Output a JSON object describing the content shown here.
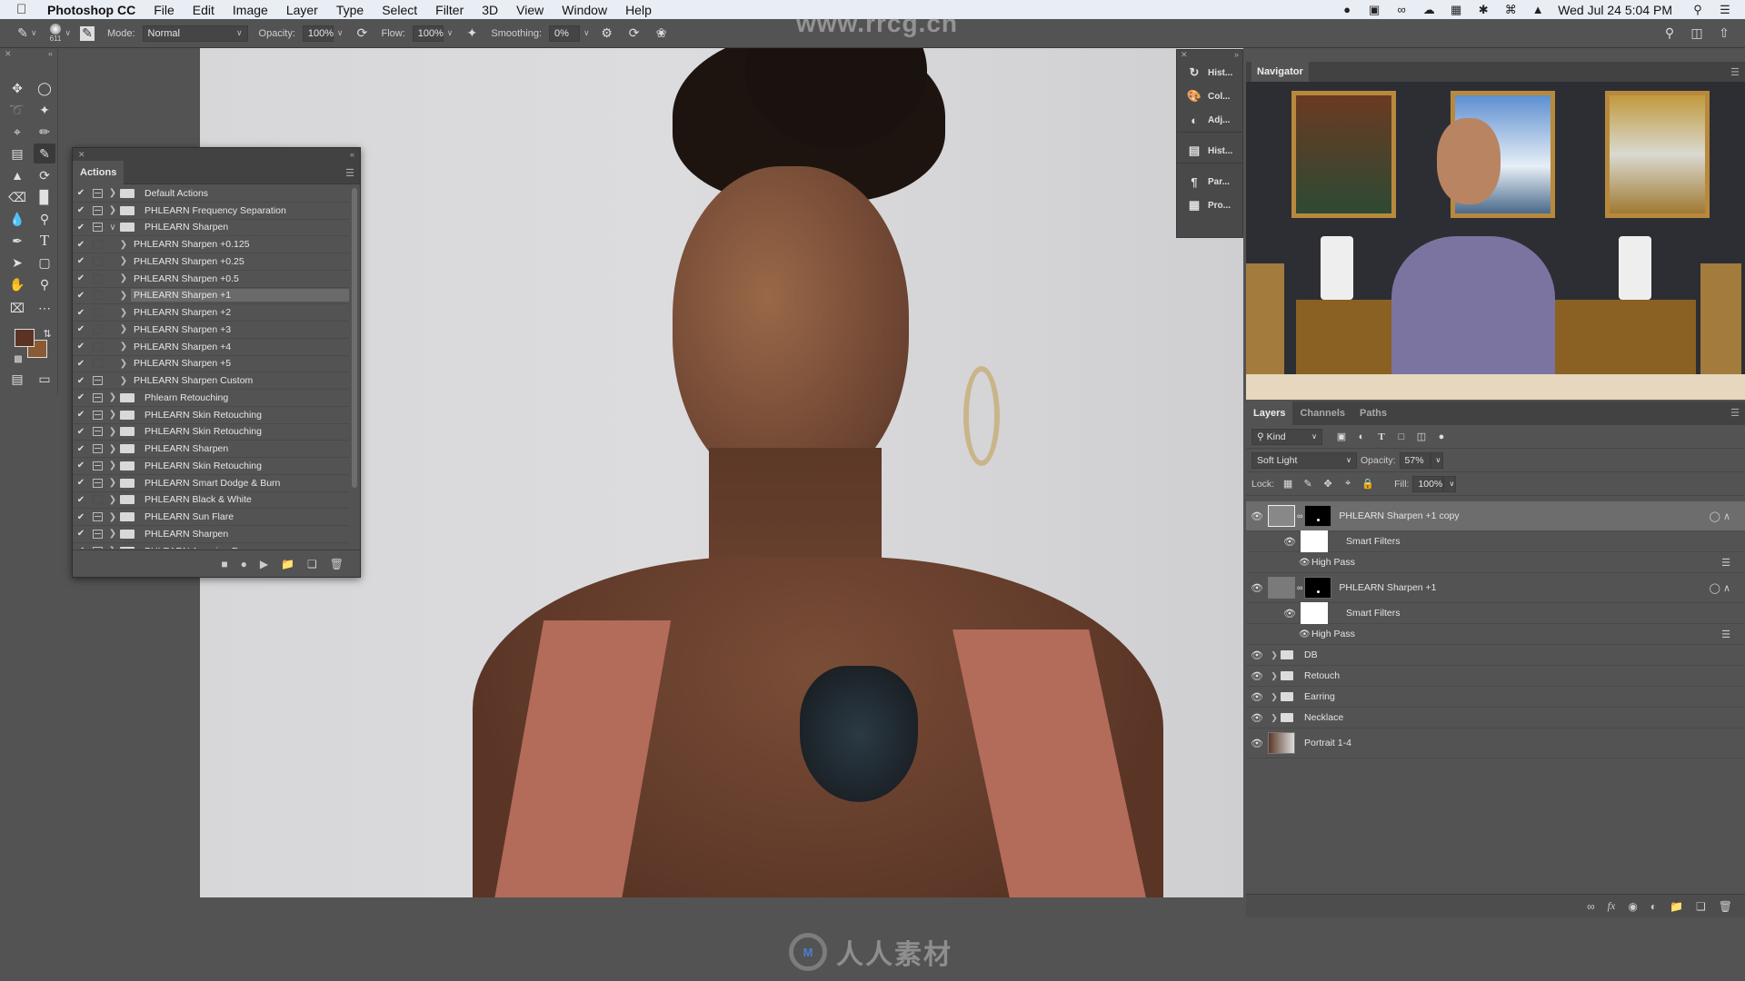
{
  "menubar": {
    "app_name": "Photoshop CC",
    "menus": [
      "File",
      "Edit",
      "Image",
      "Layer",
      "Type",
      "Select",
      "Filter",
      "3D",
      "View",
      "Window",
      "Help"
    ],
    "clock": "Wed Jul 24  5:04 PM",
    "status_icons": [
      "creative-cloud-user-icon",
      "display-icon",
      "creative-cloud-icon",
      "cloud-icon",
      "app-icon",
      "bluetooth-icon",
      "wifi-icon",
      "airplay-icon"
    ]
  },
  "options_bar": {
    "brush_size": "611",
    "mode_label": "Mode:",
    "mode_value": "Normal",
    "opacity_label": "Opacity:",
    "opacity_value": "100%",
    "flow_label": "Flow:",
    "flow_value": "100%",
    "smoothing_label": "Smoothing:",
    "smoothing_value": "0%"
  },
  "watermarks": {
    "top": "www.rrcg.cn",
    "bottom_logo": "M",
    "bottom_text": "人人素材"
  },
  "colors": {
    "foreground": "#5a3325",
    "background": "#8b5a32"
  },
  "actions_panel": {
    "title": "Actions",
    "rows": [
      {
        "label": "Default Actions",
        "type": "set",
        "checked": true,
        "dialog": true,
        "expanded": false
      },
      {
        "label": "PHLEARN Frequency Separation",
        "type": "set",
        "checked": true,
        "dialog": true,
        "expanded": false
      },
      {
        "label": "PHLEARN Sharpen",
        "type": "set",
        "checked": true,
        "dialog": true,
        "expanded": true
      },
      {
        "label": "PHLEARN Sharpen +0.125",
        "type": "action",
        "checked": true,
        "dialog": false
      },
      {
        "label": "PHLEARN Sharpen +0.25",
        "type": "action",
        "checked": true,
        "dialog": false
      },
      {
        "label": "PHLEARN Sharpen +0.5",
        "type": "action",
        "checked": true,
        "dialog": false
      },
      {
        "label": "PHLEARN Sharpen +1",
        "type": "action",
        "checked": true,
        "dialog": false,
        "selected": true
      },
      {
        "label": "PHLEARN Sharpen +2",
        "type": "action",
        "checked": true,
        "dialog": false
      },
      {
        "label": "PHLEARN Sharpen +3",
        "type": "action",
        "checked": true,
        "dialog": false
      },
      {
        "label": "PHLEARN Sharpen +4",
        "type": "action",
        "checked": true,
        "dialog": false
      },
      {
        "label": "PHLEARN Sharpen +5",
        "type": "action",
        "checked": true,
        "dialog": false
      },
      {
        "label": "PHLEARN Sharpen Custom",
        "type": "action",
        "checked": true,
        "dialog": true
      },
      {
        "label": "Phlearn Retouching",
        "type": "set",
        "checked": true,
        "dialog": true
      },
      {
        "label": "PHLEARN Skin Retouching",
        "type": "set",
        "checked": true,
        "dialog": true
      },
      {
        "label": "PHLEARN Skin Retouching",
        "type": "set",
        "checked": true,
        "dialog": true
      },
      {
        "label": "PHLEARN Sharpen",
        "type": "set",
        "checked": true,
        "dialog": true
      },
      {
        "label": "PHLEARN Skin Retouching",
        "type": "set",
        "checked": true,
        "dialog": true
      },
      {
        "label": "PHLEARN Smart Dodge & Burn",
        "type": "set",
        "checked": true,
        "dialog": true
      },
      {
        "label": "PHLEARN Black & White",
        "type": "set",
        "checked": true,
        "dialog": false
      },
      {
        "label": "PHLEARN Sun Flare",
        "type": "set",
        "checked": true,
        "dialog": true
      },
      {
        "label": "PHLEARN Sharpen",
        "type": "set",
        "checked": true,
        "dialog": true
      },
      {
        "label": "PHLEARN Amazing Eyes",
        "type": "set",
        "checked": true,
        "dialog": true
      }
    ],
    "footer_buttons": [
      "stop-icon",
      "record-icon",
      "play-icon",
      "new-set-icon",
      "new-action-icon",
      "trash-icon"
    ]
  },
  "panel_strip": {
    "items": [
      {
        "label": "Hist...",
        "icon": "history-icon"
      },
      {
        "label": "Col...",
        "icon": "color-palette-icon"
      },
      {
        "label": "Adj...",
        "icon": "adjustments-icon"
      },
      {
        "label": "Hist...",
        "icon": "histogram-icon"
      },
      {
        "label": "Par...",
        "icon": "paragraph-icon"
      },
      {
        "label": "Pro...",
        "icon": "properties-icon"
      }
    ]
  },
  "navigator": {
    "title": "Navigator"
  },
  "layers_panel": {
    "tabs": [
      "Layers",
      "Channels",
      "Paths"
    ],
    "active_tab": "Layers",
    "filter_label": "Kind",
    "blend_mode": "Soft Light",
    "opacity_label": "Opacity:",
    "opacity_value": "57%",
    "lock_label": "Lock:",
    "fill_label": "Fill:",
    "fill_value": "100%",
    "layers": [
      {
        "name": "PHLEARN Sharpen +1 copy",
        "kind": "smart-object",
        "visible": true,
        "selected": true
      },
      {
        "name": "Smart Filters",
        "kind": "smart-filters",
        "visible": true
      },
      {
        "name": "High Pass",
        "kind": "filter",
        "visible": true
      },
      {
        "name": "PHLEARN Sharpen +1",
        "kind": "smart-object",
        "visible": true
      },
      {
        "name": "Smart Filters",
        "kind": "smart-filters",
        "visible": true
      },
      {
        "name": "High Pass",
        "kind": "filter",
        "visible": true
      },
      {
        "name": "DB",
        "kind": "group",
        "visible": true
      },
      {
        "name": "Retouch",
        "kind": "group",
        "visible": true
      },
      {
        "name": "Earring",
        "kind": "group",
        "visible": true
      },
      {
        "name": "Necklace",
        "kind": "group",
        "visible": true
      },
      {
        "name": "Portrait 1-4",
        "kind": "image",
        "visible": true
      }
    ],
    "footer_buttons": [
      "link-icon",
      "fx-icon",
      "mask-icon",
      "adjustment-icon",
      "group-icon",
      "new-layer-icon",
      "trash-icon"
    ]
  }
}
